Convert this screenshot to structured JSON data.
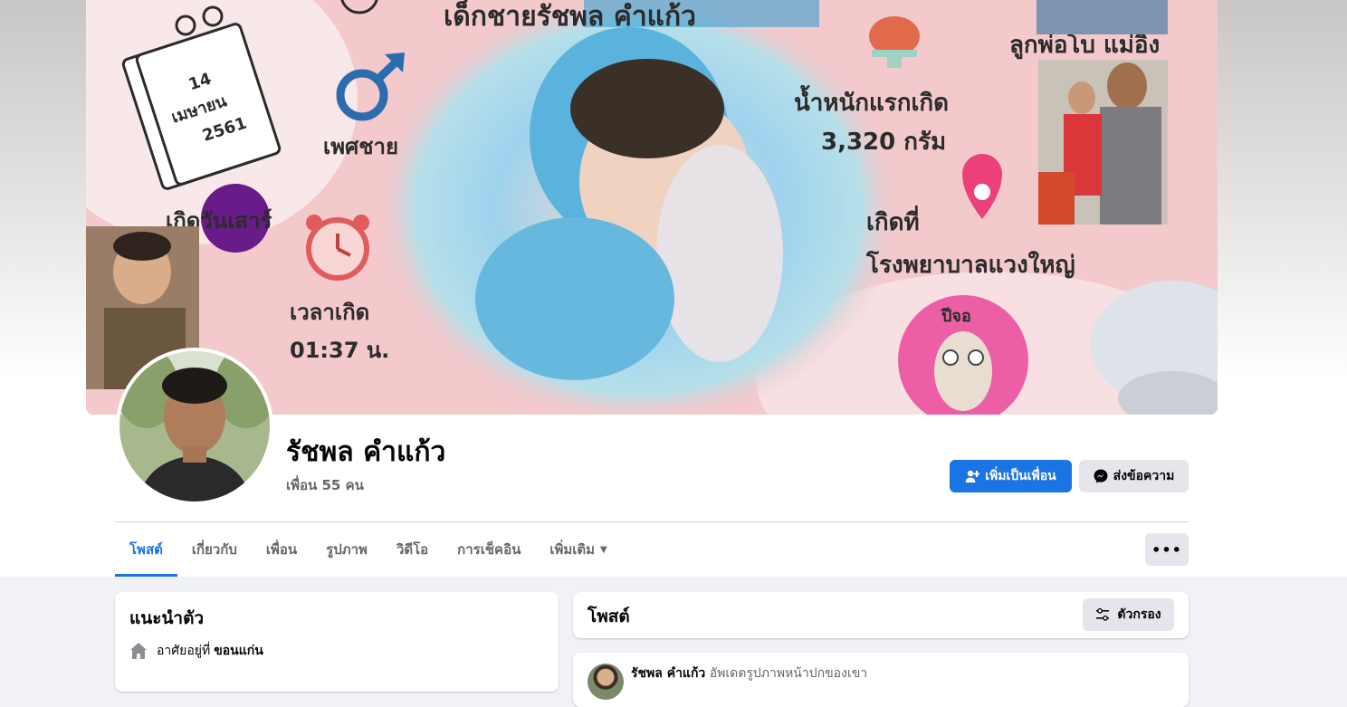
{
  "cover": {
    "title_text": "เด็กชายรัชพล คำแก้ว",
    "calendar_day": "14",
    "calendar_month": "เมษายน",
    "calendar_year": "2561",
    "gender_text": "เพศชาย",
    "birthday_text": "เกิดวันเสาร์",
    "birth_time_label": "เวลาเกิด",
    "birth_time_value": "01:37 น.",
    "weight_label": "น้ำหนักแรกเกิด",
    "weight_value": "3,320 กรัม",
    "parents_text": "ลูกพ่อโบ แม่อิง",
    "birthplace_label": "เกิดที่",
    "birthplace_value": "โรงพยาบาลแวงใหญ่",
    "zodiac_text": "ปีจอ"
  },
  "profile": {
    "name": "รัชพล คำแก้ว",
    "friends": "เพื่อน 55 คน"
  },
  "actions": {
    "add_friend": "เพิ่มเป็นเพื่อน",
    "message": "ส่งข้อความ"
  },
  "tabs": [
    {
      "label": "โพสต์",
      "active": true
    },
    {
      "label": "เกี่ยวกับ"
    },
    {
      "label": "เพื่อน"
    },
    {
      "label": "รูปภาพ"
    },
    {
      "label": "วิดีโอ"
    },
    {
      "label": "การเช็คอิน"
    },
    {
      "label": "เพิ่มเติม"
    }
  ],
  "more_menu": "•••",
  "intro": {
    "title": "แนะนำตัว",
    "lives_in_prefix": "อาศัยอยู่ที่",
    "lives_in_value": "ขอนแก่น"
  },
  "posts": {
    "title": "โพสต์",
    "filter": "ตัวกรอง"
  },
  "post": {
    "author": "รัชพล คำแก้ว",
    "action": "อัพเดตรูปภาพหน้าปกของเขา"
  },
  "colors": {
    "accent": "#1b74e4",
    "page_bg": "#f0f2f5",
    "cover_pink": "#f3c9cc"
  }
}
